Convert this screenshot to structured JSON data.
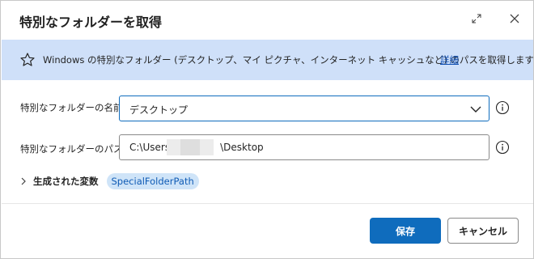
{
  "dialog": {
    "title": "特別なフォルダーを取得"
  },
  "banner": {
    "text": "Windows の特別なフォルダー (デスクトップ、マイ ピクチャ、インターネット キャッシュなど) のパスを取得します",
    "link": "詳細"
  },
  "fields": {
    "folder_name": {
      "label": "特別なフォルダーの名前:",
      "value": "デスクトップ"
    },
    "folder_path": {
      "label": "特別なフォルダーのパス:",
      "value_prefix": "C:\\Users\\",
      "value_suffix": "\\Desktop"
    }
  },
  "variables": {
    "label": "生成された変数",
    "items": [
      "SpecialFolderPath"
    ]
  },
  "buttons": {
    "save": "保存",
    "cancel": "キャンセル"
  },
  "colors": {
    "accent": "#0f6cbd",
    "banner_bg": "#cfe0f9",
    "pill_bg": "#cfe4f8"
  },
  "icons": {
    "expand": "expand-icon",
    "close": "close-icon",
    "banner": "star-icon",
    "info": "info-icon",
    "dropdown": "chevron-down-icon",
    "vars": "chevron-right-icon"
  }
}
